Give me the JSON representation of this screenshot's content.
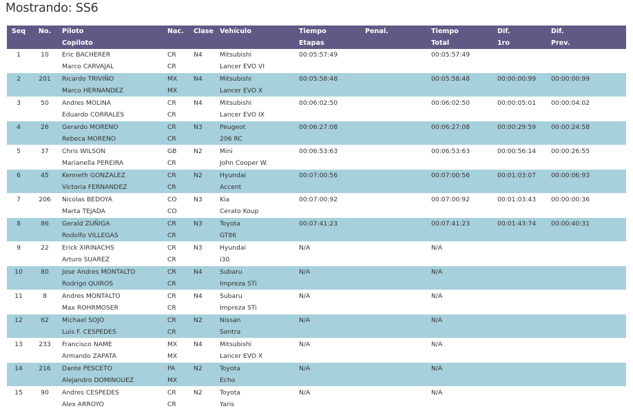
{
  "page": {
    "title": "Mostrando: SS6"
  },
  "columns": [
    [
      "Seq",
      ""
    ],
    [
      "No.",
      ""
    ],
    [
      "Piloto",
      "Copiloto"
    ],
    [
      "Nac.",
      ""
    ],
    [
      "Clase",
      ""
    ],
    [
      "Vehículo",
      ""
    ],
    [
      "Tiempo",
      "Etapas"
    ],
    [
      "Penal.",
      ""
    ],
    [
      "Tiempo",
      "Total"
    ],
    [
      "Dif.",
      "1ro"
    ],
    [
      "Dif.",
      "Prev."
    ]
  ],
  "entries": [
    {
      "seq": "1",
      "no": "10",
      "piloto": "Eric BACHERER",
      "copiloto": "Marco CARVAJAL",
      "nac1": "CR",
      "nac2": "CR",
      "clase": "N4",
      "marca": "Mitsubishi",
      "modelo": "Lancer EVO VI",
      "etapas": "00:05:57:49",
      "penal": "",
      "total": "00:05:57:49",
      "dif1": "",
      "difprev": ""
    },
    {
      "seq": "2",
      "no": "201",
      "piloto": "Ricardo TRIVIÑO",
      "copiloto": "Marco HERNANDEZ",
      "nac1": "MX",
      "nac2": "MX",
      "clase": "N4",
      "marca": "Mitsubishi",
      "modelo": "Lancer EVO X",
      "etapas": "00:05:58:48",
      "penal": "",
      "total": "00:05:58:48",
      "dif1": "00:00:00:99",
      "difprev": "00:00:00:99"
    },
    {
      "seq": "3",
      "no": "50",
      "piloto": "Andres MOLINA",
      "copiloto": "Eduardo CORRALES",
      "nac1": "CR",
      "nac2": "CR",
      "clase": "N4",
      "marca": "Mitsubishi",
      "modelo": "Lancer EVO IX",
      "etapas": "00:06:02:50",
      "penal": "",
      "total": "00:06:02:50",
      "dif1": "00:00:05:01",
      "difprev": "00:00:04:02"
    },
    {
      "seq": "4",
      "no": "26",
      "piloto": "Gerardo MORENO",
      "copiloto": "Rebeca MORENO",
      "nac1": "CR",
      "nac2": "CR",
      "clase": "N3",
      "marca": "Peugeot",
      "modelo": "206 RC",
      "etapas": "00:06:27:08",
      "penal": "",
      "total": "00:06:27:08",
      "dif1": "00:00:29:59",
      "difprev": "00:00:24:58"
    },
    {
      "seq": "5",
      "no": "37",
      "piloto": "Chris WILSON",
      "copiloto": "Marianella PEREIRA",
      "nac1": "GB",
      "nac2": "CR",
      "clase": "N2",
      "marca": "Mini",
      "modelo": "John Cooper W.",
      "etapas": "00:06:53:63",
      "penal": "",
      "total": "00:06:53:63",
      "dif1": "00:00:56:14",
      "difprev": "00:00:26:55"
    },
    {
      "seq": "6",
      "no": "45",
      "piloto": "Kenneth GONZALEZ",
      "copiloto": "Victoria FERNANDEZ",
      "nac1": "CR",
      "nac2": "CR",
      "clase": "N2",
      "marca": "Hyundai",
      "modelo": "Accent",
      "etapas": "00:07:00:56",
      "penal": "",
      "total": "00:07:00:56",
      "dif1": "00:01:03:07",
      "difprev": "00:00:06:93"
    },
    {
      "seq": "7",
      "no": "206",
      "piloto": "Nicolas BEDOYA",
      "copiloto": "Marta TEJADA",
      "nac1": "CO",
      "nac2": "CO",
      "clase": "N3",
      "marca": "Kia",
      "modelo": "Cerato Koup",
      "etapas": "00:07:00:92",
      "penal": "",
      "total": "00:07:00:92",
      "dif1": "00:01:03:43",
      "difprev": "00:00:00:36"
    },
    {
      "seq": "8",
      "no": "86",
      "piloto": "Gerald ZUÑIGA",
      "copiloto": "Rodolfo VILLEGAS",
      "nac1": "CR",
      "nac2": "CR",
      "clase": "N3",
      "marca": "Toyota",
      "modelo": "GT86",
      "etapas": "00:07:41:23",
      "penal": "",
      "total": "00:07:41:23",
      "dif1": "00:01:43:74",
      "difprev": "00:00:40:31"
    },
    {
      "seq": "9",
      "no": "22",
      "piloto": "Erick XIRINACHS",
      "copiloto": "Arturo SUAREZ",
      "nac1": "CR",
      "nac2": "CR",
      "clase": "N3",
      "marca": "Hyundai",
      "modelo": "i30",
      "etapas": "N/A",
      "penal": "",
      "total": "N/A",
      "dif1": "",
      "difprev": ""
    },
    {
      "seq": "10",
      "no": "80",
      "piloto": "Jose Andres MONTALTO",
      "copiloto": "Rodrigo QUIROS",
      "nac1": "CR",
      "nac2": "CR",
      "clase": "N4",
      "marca": "Subaru",
      "modelo": "Impreza STi",
      "etapas": "N/A",
      "penal": "",
      "total": "N/A",
      "dif1": "",
      "difprev": ""
    },
    {
      "seq": "11",
      "no": "8",
      "piloto": "Andres MONTALTO",
      "copiloto": "Max ROHRMOSER",
      "nac1": "CR",
      "nac2": "CR",
      "clase": "N4",
      "marca": "Subaru",
      "modelo": "Impreza STi",
      "etapas": "N/A",
      "penal": "",
      "total": "N/A",
      "dif1": "",
      "difprev": ""
    },
    {
      "seq": "12",
      "no": "62",
      "piloto": "Michael SOJO",
      "copiloto": "Luis F. CESPEDES",
      "nac1": "CR",
      "nac2": "CR",
      "clase": "N2",
      "marca": "Nissan",
      "modelo": "Sentra",
      "etapas": "N/A",
      "penal": "",
      "total": "N/A",
      "dif1": "",
      "difprev": ""
    },
    {
      "seq": "13",
      "no": "233",
      "piloto": "Francisco NAME",
      "copiloto": "Armando ZAPATA",
      "nac1": "MX",
      "nac2": "MX",
      "clase": "N4",
      "marca": "Mitsubishi",
      "modelo": "Lancer EVO X",
      "etapas": "N/A",
      "penal": "",
      "total": "N/A",
      "dif1": "",
      "difprev": ""
    },
    {
      "seq": "14",
      "no": "216",
      "piloto": "Dante PESCETO",
      "copiloto": "Alejandro DOMINGUEZ",
      "nac1": "PA",
      "nac2": "MX",
      "clase": "N2",
      "marca": "Toyota",
      "modelo": "Echo",
      "etapas": "N/A",
      "penal": "",
      "total": "N/A",
      "dif1": "",
      "difprev": ""
    },
    {
      "seq": "15",
      "no": "90",
      "piloto": "Andres CESPEDES",
      "copiloto": "Alex ARROYO",
      "nac1": "CR",
      "nac2": "CR",
      "clase": "N2",
      "marca": "Toyota",
      "modelo": "Yaris",
      "etapas": "N/A",
      "penal": "",
      "total": "N/A",
      "dif1": "",
      "difprev": ""
    }
  ]
}
